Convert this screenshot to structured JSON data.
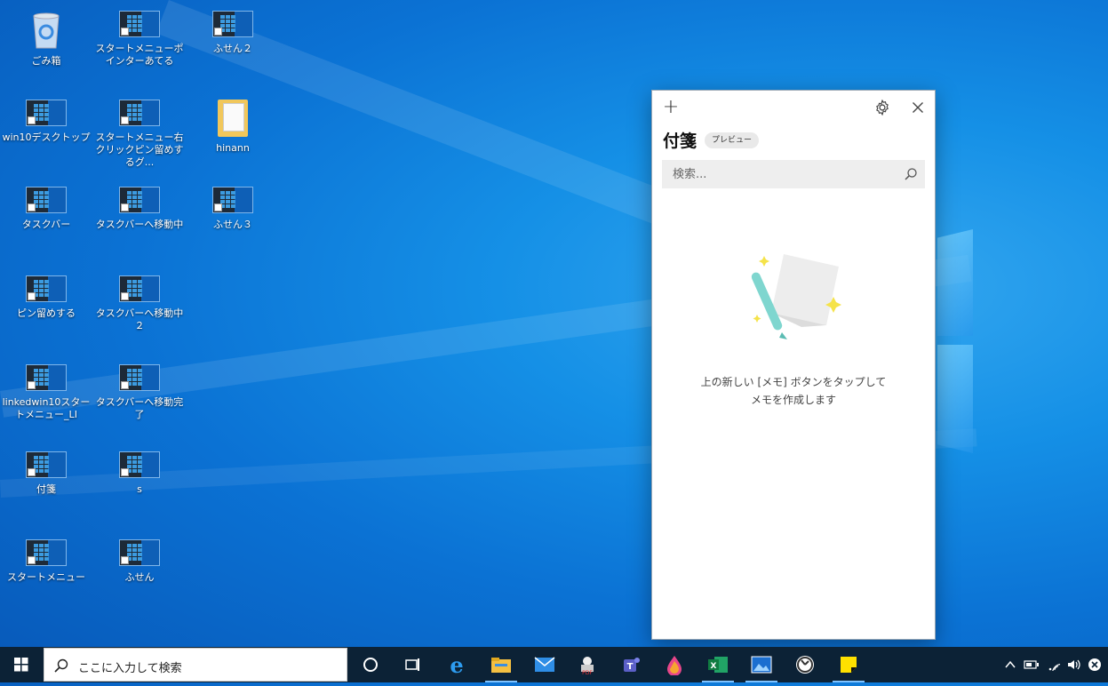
{
  "desktop": {
    "icons": [
      {
        "label": "ごみ箱",
        "type": "recycle-bin-icon"
      },
      {
        "label": "スタートメニューポインターあてる",
        "type": "screenshot-file-icon"
      },
      {
        "label": "ふせん２",
        "type": "screenshot-file-icon"
      },
      {
        "label": "win10デスクトップ",
        "type": "screenshot-file-icon"
      },
      {
        "label": "スタートメニュー右クリックピン留めするグ...",
        "type": "screenshot-file-icon"
      },
      {
        "label": "hinann",
        "type": "folder-icon"
      },
      {
        "label": "タスクバー",
        "type": "screenshot-file-icon"
      },
      {
        "label": "タスクバーへ移動中",
        "type": "screenshot-file-icon"
      },
      {
        "label": "ふせん３",
        "type": "screenshot-file-icon"
      },
      {
        "label": "ピン留めする",
        "type": "screenshot-file-icon"
      },
      {
        "label": "タスクバーへ移動中２",
        "type": "screenshot-file-icon"
      },
      {
        "label": "linkedwin10スタートメニュー_LI",
        "type": "screenshot-file-icon"
      },
      {
        "label": "タスクバーへ移動完了",
        "type": "screenshot-file-icon"
      },
      {
        "label": "付箋",
        "type": "screenshot-file-icon"
      },
      {
        "label": "s",
        "type": "screenshot-file-icon"
      },
      {
        "label": "スタートメニュー",
        "type": "screenshot-file-icon"
      },
      {
        "label": "ふせん",
        "type": "screenshot-file-icon"
      }
    ]
  },
  "sticky_notes": {
    "title": "付箋",
    "badge": "プレビュー",
    "search_placeholder": "検索...",
    "empty_line1": "上の新しい [メモ] ボタンをタップして",
    "empty_line2": "メモを作成します",
    "icons": {
      "add": "plus-icon",
      "settings": "gear-icon",
      "close": "close-icon",
      "search": "search-icon"
    }
  },
  "taskbar": {
    "search_placeholder": "ここに入力して検索",
    "apps": [
      "cortana-icon",
      "task-view-icon",
      "edge-icon",
      "file-explorer-icon",
      "mail-icon",
      "pdf-app-icon",
      "teams-icon",
      "paint-icon",
      "excel-icon",
      "photos-icon",
      "clock-app-icon",
      "sticky-notes-icon"
    ],
    "tray": [
      "chevron-up-icon",
      "battery-icon",
      "wifi-icon",
      "volume-icon",
      "notification-icon"
    ]
  },
  "colors": {
    "taskbar": "#0c2236",
    "desktop_accent": "#0b72d4",
    "sticky_yellow": "#ffe100"
  }
}
